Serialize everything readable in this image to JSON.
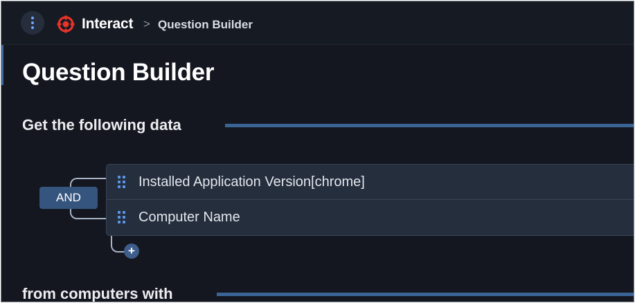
{
  "header": {
    "menu_icon": "more-vertical-icon",
    "logo_icon": "interact-target-icon",
    "app_name": "Interact",
    "breadcrumb_separator": ">",
    "breadcrumb_current": "Question Builder"
  },
  "page": {
    "title": "Question Builder"
  },
  "get_section": {
    "title": "Get the following data",
    "operator": "AND",
    "rows": [
      {
        "label": "Installed Application Version[chrome]",
        "handle_icon": "drag-handle-icon"
      },
      {
        "label": "Computer Name",
        "handle_icon": "drag-handle-icon"
      }
    ],
    "add_icon": "plus-icon",
    "add_label": "+"
  },
  "filter_section": {
    "title": "from computers with"
  },
  "colors": {
    "background": "#14171f",
    "accent": "#3b6496",
    "operator_button": "#35557f",
    "row_background": "#252e3d",
    "logo": "#e8332a"
  }
}
